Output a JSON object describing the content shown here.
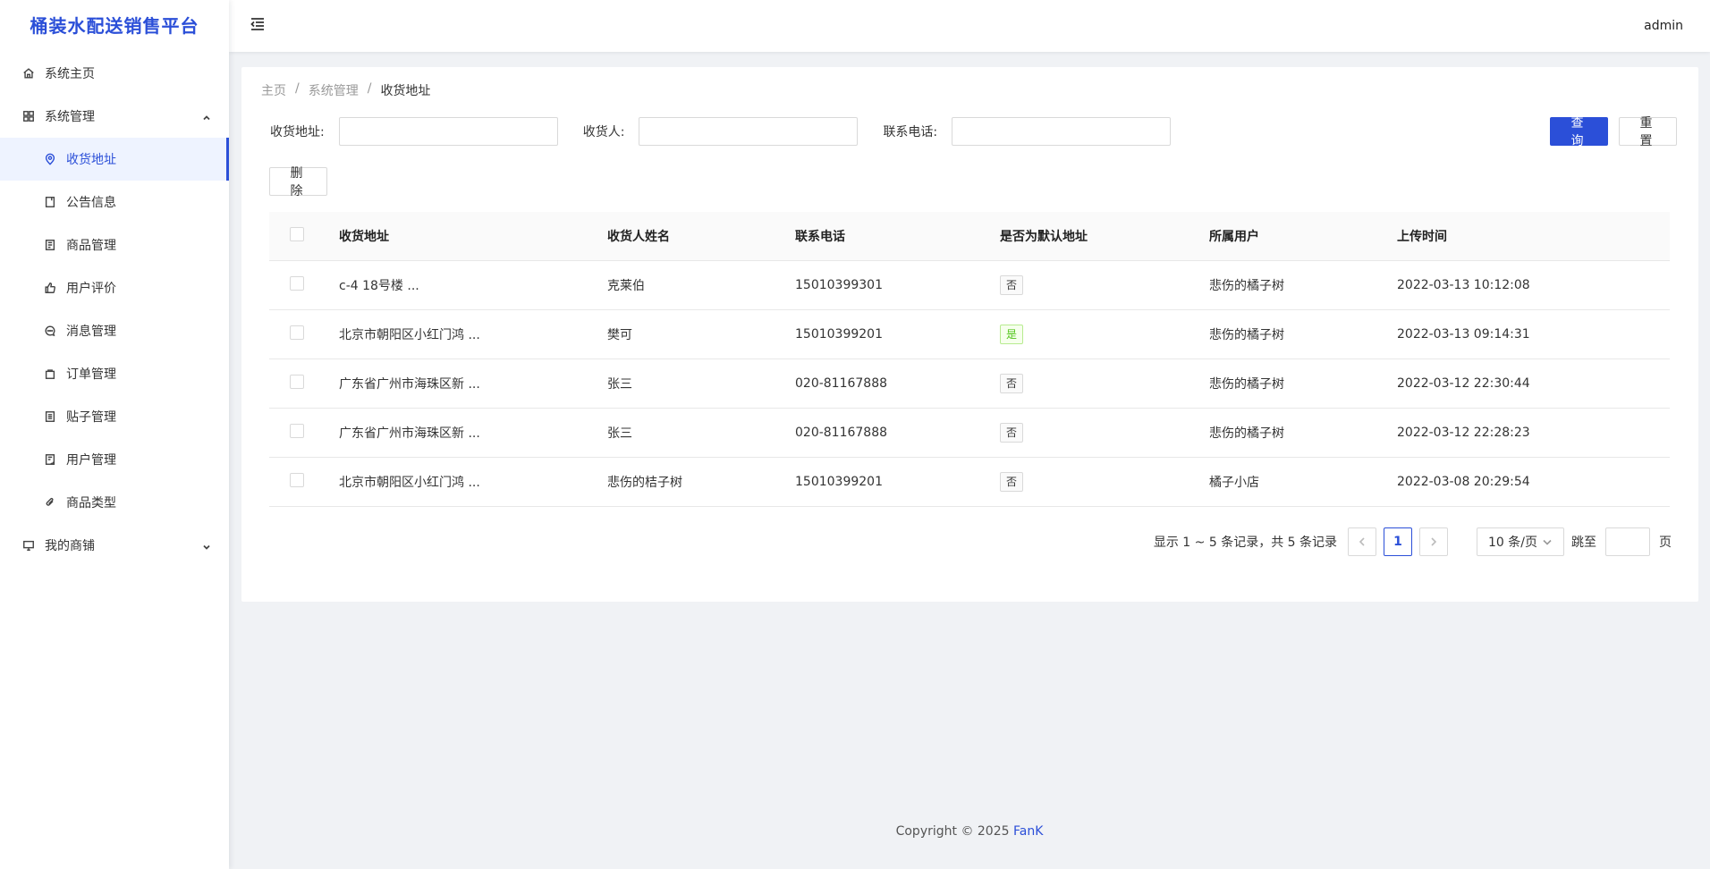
{
  "app": {
    "title": "桶装水配送销售平台"
  },
  "header": {
    "user": "admin"
  },
  "sidebar": {
    "items": [
      {
        "label": "系统主页",
        "icon": "home-icon"
      },
      {
        "label": "系统管理",
        "icon": "grid-icon",
        "expanded": true,
        "children": [
          {
            "label": "收货地址",
            "icon": "location-icon",
            "active": true
          },
          {
            "label": "公告信息",
            "icon": "notice-icon"
          },
          {
            "label": "商品管理",
            "icon": "goods-icon"
          },
          {
            "label": "用户评价",
            "icon": "thumb-up-icon"
          },
          {
            "label": "消息管理",
            "icon": "message-icon"
          },
          {
            "label": "订单管理",
            "icon": "bag-icon"
          },
          {
            "label": "贴子管理",
            "icon": "post-icon"
          },
          {
            "label": "用户管理",
            "icon": "user-doc-icon"
          },
          {
            "label": "商品类型",
            "icon": "paperclip-icon"
          }
        ]
      },
      {
        "label": "我的商铺",
        "icon": "monitor-icon",
        "expanded": false
      }
    ]
  },
  "breadcrumb": [
    "主页",
    "系统管理",
    "收货地址"
  ],
  "filters": {
    "address_label": "收货地址:",
    "receiver_label": "收货人:",
    "phone_label": "联系电话:",
    "address_value": "",
    "receiver_value": "",
    "phone_value": ""
  },
  "buttons": {
    "query": "查询",
    "reset": "重置",
    "delete": "删除"
  },
  "table": {
    "headers": [
      "收货地址",
      "收货人姓名",
      "联系电话",
      "是否为默认地址",
      "所属用户",
      "上传时间"
    ],
    "rows": [
      {
        "address": "c-4 18号楼 ...",
        "name": "克莱伯",
        "phone": "15010399301",
        "default": "否",
        "user": "悲伤的橘子树",
        "time": "2022-03-13 10:12:08"
      },
      {
        "address": "北京市朝阳区小红门鸿 ...",
        "name": "樊可",
        "phone": "15010399201",
        "default": "是",
        "user": "悲伤的橘子树",
        "time": "2022-03-13 09:14:31"
      },
      {
        "address": "广东省广州市海珠区新 ...",
        "name": "张三",
        "phone": "020-81167888",
        "default": "否",
        "user": "悲伤的橘子树",
        "time": "2022-03-12 22:30:44"
      },
      {
        "address": "广东省广州市海珠区新 ...",
        "name": "张三",
        "phone": "020-81167888",
        "default": "否",
        "user": "悲伤的橘子树",
        "time": "2022-03-12 22:28:23"
      },
      {
        "address": "北京市朝阳区小红门鸿 ...",
        "name": "悲伤的桔子树",
        "phone": "15010399201",
        "default": "否",
        "user": "橘子小店",
        "time": "2022-03-08 20:29:54"
      }
    ]
  },
  "pagination": {
    "total_text": "显示 1 ~ 5 条记录，共 5 条记录",
    "current": "1",
    "page_size": "10 条/页",
    "jump_label": "跳至",
    "page_suffix": "页"
  },
  "footer": {
    "copyright": "Copyright © 2025",
    "brand": "FanK"
  },
  "colors": {
    "primary": "#2b4fd8",
    "success": "#52c41a"
  }
}
